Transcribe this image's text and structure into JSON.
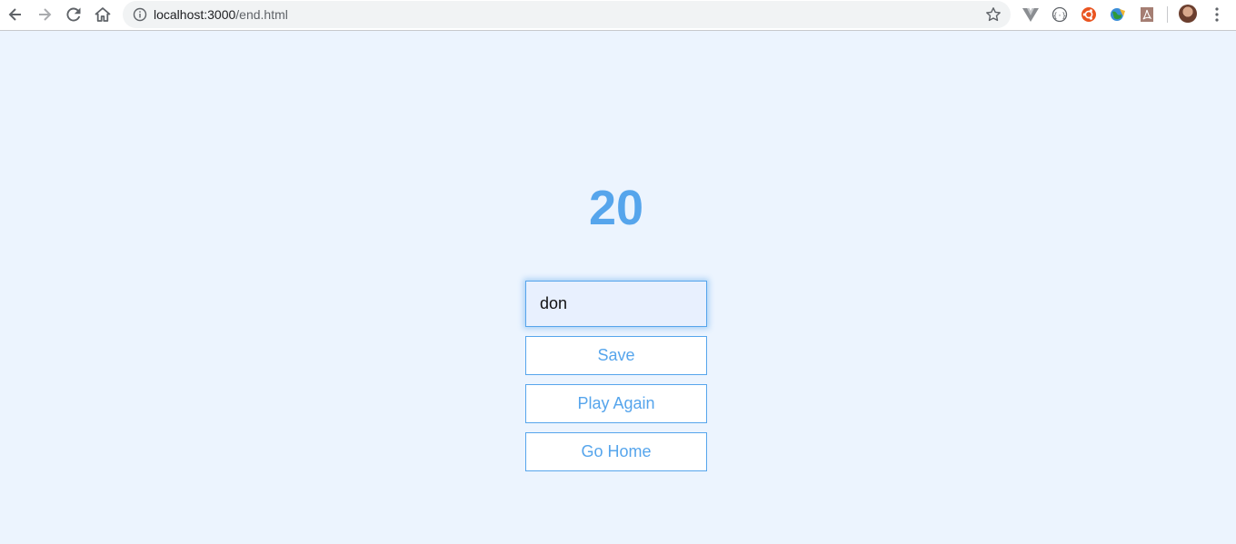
{
  "browser": {
    "url_host": "localhost:3000",
    "url_path": "/end.html",
    "icons": {
      "back": "back-arrow-icon",
      "forward": "forward-arrow-icon",
      "reload": "reload-icon",
      "home": "home-icon",
      "info": "info-icon",
      "bookmark": "star-icon",
      "menu": "kebab-menu-icon"
    },
    "extensions": [
      "vue-devtools-icon",
      "json-viewer-icon",
      "ubuntu-extension-icon",
      "globe-extension-icon",
      "pdf-extension-icon"
    ]
  },
  "end": {
    "final_score": "20",
    "username_value": "don",
    "username_placeholder": "",
    "save_label": "Save",
    "play_again_label": "Play Again",
    "go_home_label": "Go Home"
  },
  "colors": {
    "accent": "#56a5ec",
    "background": "#ecf4fe",
    "input_background": "#e8f0fe"
  }
}
